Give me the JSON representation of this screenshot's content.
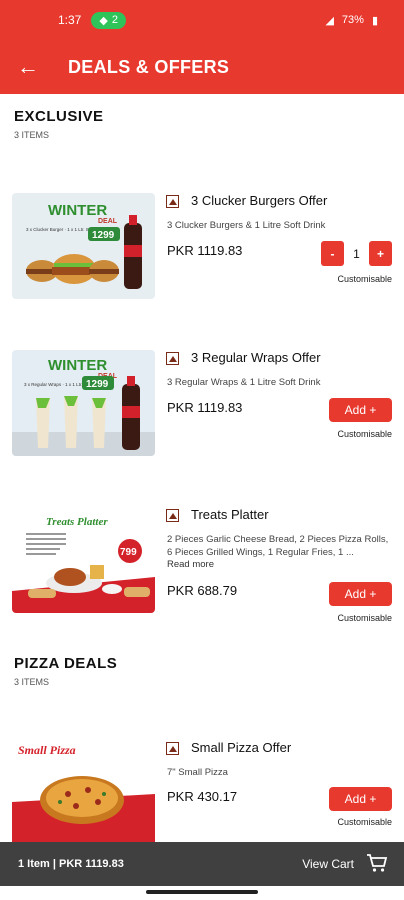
{
  "status": {
    "time": "1:37",
    "hotspot_count": "2",
    "battery": "73%"
  },
  "header": {
    "title": "DEALS & OFFERS"
  },
  "sections": [
    {
      "title": "EXCLUSIVE",
      "count": "3 ITEMS",
      "items": [
        {
          "name": "3 Clucker Burgers Offer",
          "desc": "3 Clucker Burgers & 1 Litre Soft Drink",
          "price": "PKR 1119.83",
          "qty": "1",
          "custom": "Customisable",
          "promo": {
            "headline": "WINTER",
            "sub": "DEAL",
            "badge": "1299",
            "lines": "3 x Clucker Burger · 1 x 1 Ltr. Soft Drink"
          }
        },
        {
          "name": "3 Regular Wraps Offer",
          "desc": "3 Regular Wraps & 1 Litre Soft Drink",
          "price": "PKR 1119.83",
          "add": "Add +",
          "custom": "Customisable",
          "promo": {
            "headline": "WINTER",
            "sub": "DEAL",
            "badge": "1299",
            "lines": "3 x Regular Wraps · 1 x 1 Ltr. Soft Drink"
          }
        },
        {
          "name": "Treats Platter",
          "desc": "2 Pieces Garlic Cheese Bread, 2 Pieces Pizza Rolls, 6 Pieces Grilled Wings, 1 Regular Fries, 1 ...",
          "readmore": "Read more",
          "price": "PKR 688.79",
          "add": "Add +",
          "custom": "Customisable",
          "promo": {
            "headline": "Treats Platter",
            "badge": "799"
          }
        }
      ]
    },
    {
      "title": "PIZZA DEALS",
      "count": "3 ITEMS",
      "items": [
        {
          "name": "Small Pizza Offer",
          "desc": "7\" Small Pizza",
          "price": "PKR 430.17",
          "add": "Add +",
          "custom": "Customisable",
          "promo": {
            "headline": "Small Pizza"
          }
        }
      ]
    }
  ],
  "cart": {
    "summary": "1 Item | PKR 1119.83",
    "view": "View Cart"
  }
}
